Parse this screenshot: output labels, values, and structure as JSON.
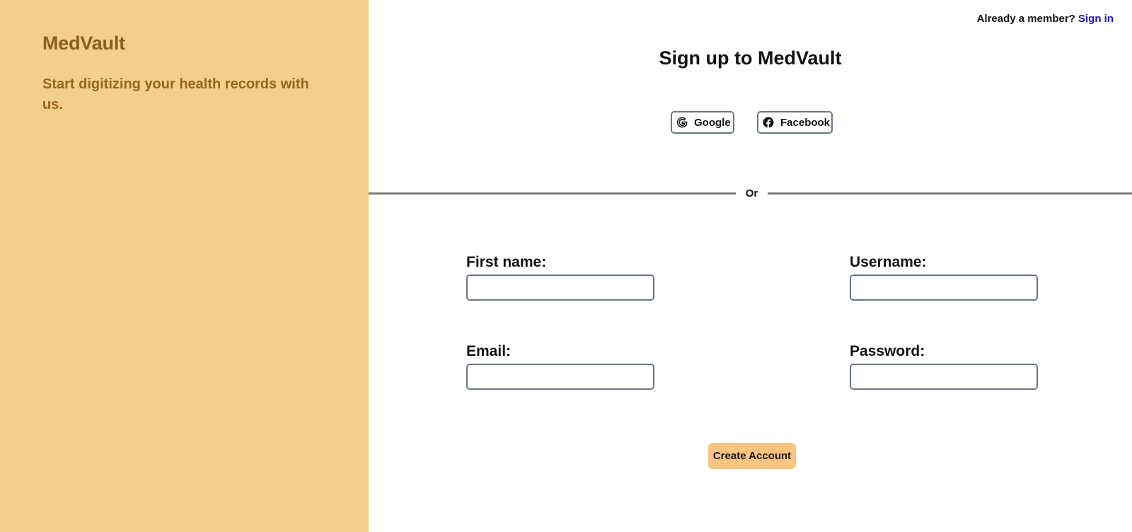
{
  "brand": {
    "name": "MedVault",
    "tagline": "Start digitizing your health records with us."
  },
  "header": {
    "member_prompt": "Already a member?",
    "signin_label": "Sign in"
  },
  "signup": {
    "title": "Sign up to MedVault",
    "social": [
      {
        "label": "Google",
        "icon": "google-icon"
      },
      {
        "label": "Facebook",
        "icon": "facebook-icon"
      }
    ],
    "divider_text": "Or",
    "fields": {
      "first_name": {
        "label": "First name:",
        "value": "",
        "placeholder": ""
      },
      "username": {
        "label": "Username:",
        "value": "",
        "placeholder": ""
      },
      "email": {
        "label": "Email:",
        "value": "",
        "placeholder": ""
      },
      "password": {
        "label": "Password:",
        "value": "",
        "placeholder": ""
      }
    },
    "submit_label": "Create Account"
  },
  "colors": {
    "brand_panel_bg": "#f3d089",
    "brand_text": "#8a5f1b",
    "link": "#1c13b5",
    "primary_button": "#fbc57f",
    "input_border": "#6b7789"
  }
}
